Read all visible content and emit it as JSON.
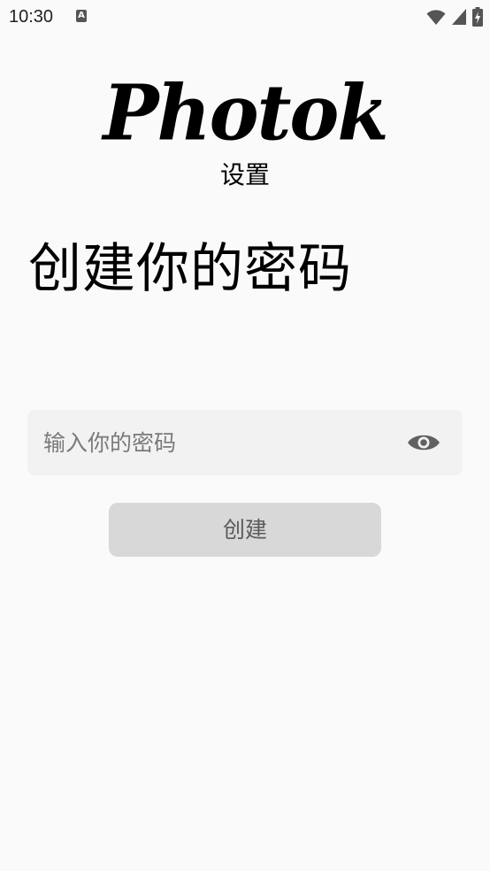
{
  "status_bar": {
    "time": "10:30",
    "notification_glyph": "A",
    "icons": [
      "wifi-icon",
      "signal-icon",
      "battery-charging-icon"
    ]
  },
  "header": {
    "logo": "Photok",
    "subtitle": "设置"
  },
  "main": {
    "title": "创建你的密码",
    "password_field": {
      "placeholder": "输入你的密码",
      "value": "",
      "toggle_icon": "eye-icon"
    },
    "create_button_label": "创建"
  },
  "colors": {
    "background": "#fafafa",
    "field_background": "#f2f2f2",
    "button_background": "#d8d8d8",
    "button_text": "#5a5a5a",
    "icon": "#616161"
  }
}
